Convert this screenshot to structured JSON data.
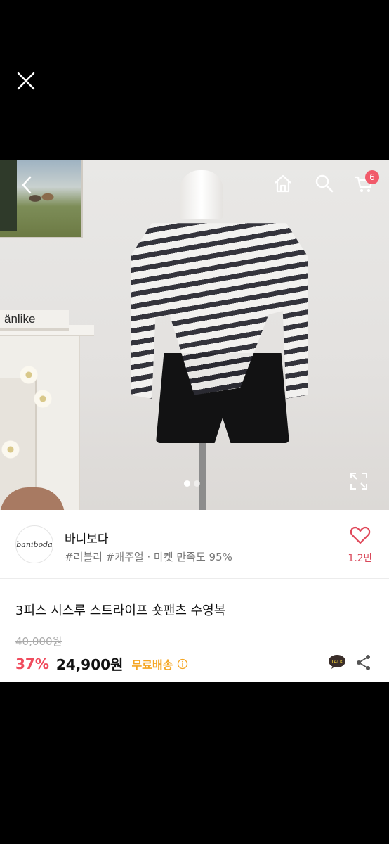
{
  "top": {
    "close_icon": "close-icon"
  },
  "hero": {
    "icons": {
      "back": "chevron-left-icon",
      "home": "home-icon",
      "search": "search-icon",
      "cart": "cart-icon",
      "expand": "expand-icon"
    },
    "cart_count": "6",
    "book_text": "änlike",
    "carousel": {
      "total": 2,
      "active": 1
    }
  },
  "shop": {
    "logo_text": "baniboda",
    "name": "바니보다",
    "tags": "#러블리 #캐주얼 · 마켓 만족도 95%",
    "like_count": "1.2만"
  },
  "product": {
    "title": "3피스 시스루 스트라이프 숏팬츠 수영복",
    "original_price": "40,000원",
    "discount": "37%",
    "price": "24,900원",
    "shipping": "무료배송"
  },
  "colors": {
    "accent": "#f04c5e",
    "shipping": "#f5a623",
    "badge": "#f15a6a"
  }
}
